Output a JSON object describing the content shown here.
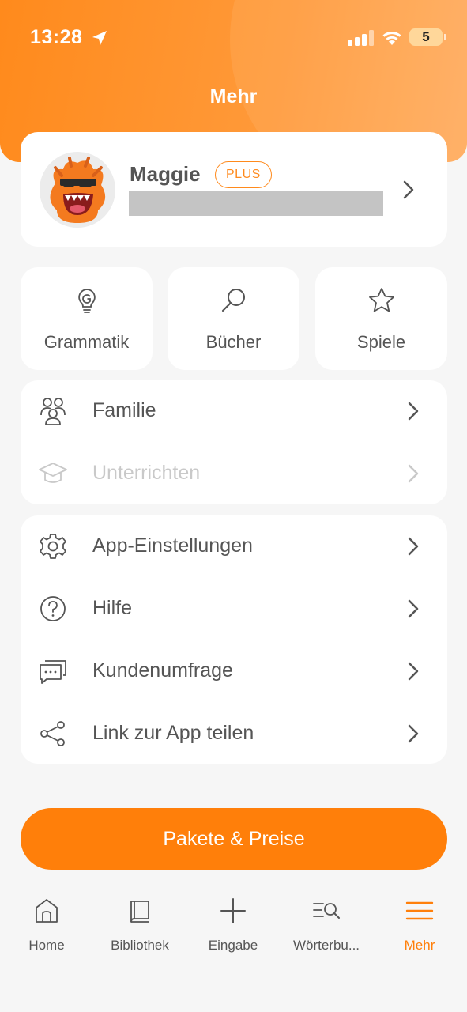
{
  "status_bar": {
    "time": "13:28",
    "battery": "5"
  },
  "header": {
    "title": "Mehr"
  },
  "profile": {
    "name": "Maggie",
    "badge": "PLUS"
  },
  "tiles": [
    {
      "label": "Grammatik",
      "icon": "lightbulb-icon"
    },
    {
      "label": "Bücher",
      "icon": "search-icon"
    },
    {
      "label": "Spiele",
      "icon": "star-icon"
    }
  ],
  "group1": [
    {
      "label": "Familie",
      "icon": "family-icon",
      "enabled": true
    },
    {
      "label": "Unterrichten",
      "icon": "graduation-cap-icon",
      "enabled": false
    }
  ],
  "group2": [
    {
      "label": "App-Einstellungen",
      "icon": "gear-icon"
    },
    {
      "label": "Hilfe",
      "icon": "help-circle-icon"
    },
    {
      "label": "Kundenumfrage",
      "icon": "chat-bubble-icon"
    },
    {
      "label": "Link zur App teilen",
      "icon": "share-icon"
    }
  ],
  "cta": {
    "label": "Pakete & Preise"
  },
  "tabs": [
    {
      "label": "Home",
      "icon": "home-icon"
    },
    {
      "label": "Bibliothek",
      "icon": "book-icon"
    },
    {
      "label": "Eingabe",
      "icon": "plus-icon"
    },
    {
      "label": "Wörterbu...",
      "icon": "dictionary-search-icon"
    },
    {
      "label": "Mehr",
      "icon": "menu-icon",
      "active": true
    }
  ],
  "colors": {
    "accent": "#ff7f0a",
    "text": "#555555",
    "disabled": "#c9c9c9",
    "background": "#f6f6f6"
  }
}
